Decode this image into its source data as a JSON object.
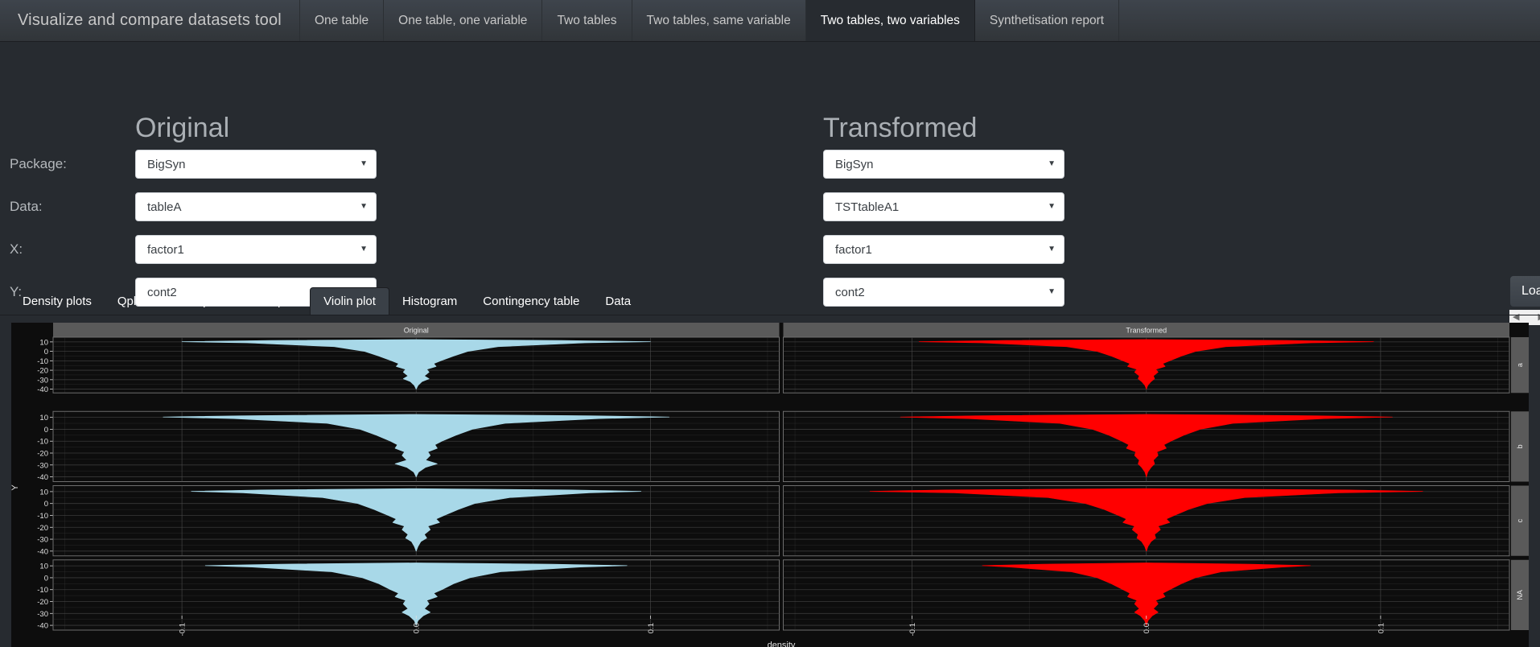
{
  "navbar": {
    "brand": "Visualize and compare datasets tool",
    "tabs": [
      {
        "label": "One table",
        "active": false
      },
      {
        "label": "One table, one variable",
        "active": false
      },
      {
        "label": "Two tables",
        "active": false
      },
      {
        "label": "Two tables, same variable",
        "active": false
      },
      {
        "label": "Two tables, two variables",
        "active": true
      },
      {
        "label": "Synthetisation report",
        "active": false
      }
    ]
  },
  "form": {
    "original_title": "Original",
    "transformed_title": "Transformed",
    "labels": {
      "package": "Package:",
      "data": "Data:",
      "x": "X:",
      "y": "Y:"
    },
    "original": {
      "package": "BigSyn",
      "data": "tableA",
      "x": "factor1",
      "y": "cont2"
    },
    "transformed": {
      "package": "BigSyn",
      "data": "TSTtableA1",
      "x": "factor1",
      "y": "cont2"
    },
    "caret": "▼",
    "load_button": "Load",
    "scroll_left": "◀",
    "scroll_right": "▶"
  },
  "subtabs": [
    {
      "label": "Density plots",
      "active": false
    },
    {
      "label": "Qplot 2",
      "active": false
    },
    {
      "label": "Boxplot",
      "active": false
    },
    {
      "label": "Jitter plot",
      "active": false
    },
    {
      "label": "Violin plot",
      "active": true
    },
    {
      "label": "Histogram",
      "active": false
    },
    {
      "label": "Contingency table",
      "active": false
    },
    {
      "label": "Data",
      "active": false
    }
  ],
  "chart_data": {
    "type": "violin",
    "title": "",
    "panel_titles": [
      "Original",
      "Transformed"
    ],
    "xlabel": "density",
    "ylabel": "Y",
    "facet_labels": [
      "a",
      "b",
      "c",
      "NA"
    ],
    "facet_var": "factor1",
    "x_ticks": [
      "-0.1",
      "0.0",
      "0.1"
    ],
    "x_tick_values": [
      -0.1,
      0.0,
      0.1
    ],
    "xlim": [
      -0.155,
      0.155
    ],
    "y_ticks": [
      "10",
      "0",
      "-10",
      "-20",
      "-30",
      "-40"
    ],
    "y_tick_values": [
      10,
      0,
      -10,
      -20,
      -30,
      -40
    ],
    "ylim": [
      -44,
      15
    ],
    "grid": true,
    "legend": "none",
    "colors": {
      "original_fill": "#a8d8e8",
      "transformed_fill": "#ff0000",
      "panel_bg": "#0d0d0d",
      "strip_bg": "#5a5a5a",
      "grid_line": "#4a4a4a",
      "text": "#e0e0e0"
    },
    "series": [
      {
        "panel": "Original",
        "facet": "a",
        "color": "#a8d8e8",
        "half_widths": [
          {
            "y": 12.5,
            "w": 0.0
          },
          {
            "y": 11.5,
            "w": 0.062
          },
          {
            "y": 10.2,
            "w": 0.1
          },
          {
            "y": 9.0,
            "w": 0.072
          },
          {
            "y": 5.0,
            "w": 0.035
          },
          {
            "y": 0.0,
            "w": 0.022
          },
          {
            "y": -5.0,
            "w": 0.016
          },
          {
            "y": -10.0,
            "w": 0.0105
          },
          {
            "y": -13.0,
            "w": 0.0075
          },
          {
            "y": -16.0,
            "w": 0.0085
          },
          {
            "y": -19.0,
            "w": 0.0045
          },
          {
            "y": -22.0,
            "w": 0.0055
          },
          {
            "y": -26.0,
            "w": 0.0035
          },
          {
            "y": -29.0,
            "w": 0.0055
          },
          {
            "y": -32.0,
            "w": 0.0025
          },
          {
            "y": -36.0,
            "w": 0.0008
          },
          {
            "y": -40.0,
            "w": 0.0
          }
        ]
      },
      {
        "panel": "Original",
        "facet": "b",
        "color": "#a8d8e8",
        "half_widths": [
          {
            "y": 12.5,
            "w": 0.0
          },
          {
            "y": 11.4,
            "w": 0.072
          },
          {
            "y": 10.3,
            "w": 0.108
          },
          {
            "y": 9.0,
            "w": 0.078
          },
          {
            "y": 5.0,
            "w": 0.038
          },
          {
            "y": 0.0,
            "w": 0.024
          },
          {
            "y": -5.0,
            "w": 0.017
          },
          {
            "y": -10.0,
            "w": 0.011
          },
          {
            "y": -13.0,
            "w": 0.008
          },
          {
            "y": -16.0,
            "w": 0.009
          },
          {
            "y": -19.0,
            "w": 0.005
          },
          {
            "y": -22.0,
            "w": 0.006
          },
          {
            "y": -26.0,
            "w": 0.004
          },
          {
            "y": -29.0,
            "w": 0.009
          },
          {
            "y": -32.0,
            "w": 0.004
          },
          {
            "y": -36.0,
            "w": 0.001
          },
          {
            "y": -40.0,
            "w": 0.0
          }
        ]
      },
      {
        "panel": "Original",
        "facet": "c",
        "color": "#a8d8e8",
        "half_widths": [
          {
            "y": 12.5,
            "w": 0.0
          },
          {
            "y": 11.4,
            "w": 0.066
          },
          {
            "y": 10.2,
            "w": 0.096
          },
          {
            "y": 9.0,
            "w": 0.074
          },
          {
            "y": 5.0,
            "w": 0.04
          },
          {
            "y": 0.0,
            "w": 0.025
          },
          {
            "y": -5.0,
            "w": 0.018
          },
          {
            "y": -10.0,
            "w": 0.012
          },
          {
            "y": -13.0,
            "w": 0.0085
          },
          {
            "y": -16.0,
            "w": 0.01
          },
          {
            "y": -19.0,
            "w": 0.005
          },
          {
            "y": -22.0,
            "w": 0.006
          },
          {
            "y": -26.0,
            "w": 0.0035
          },
          {
            "y": -29.0,
            "w": 0.0045
          },
          {
            "y": -32.0,
            "w": 0.002
          },
          {
            "y": -36.0,
            "w": 0.0008
          },
          {
            "y": -40.0,
            "w": 0.0
          }
        ]
      },
      {
        "panel": "Original",
        "facet": "NA",
        "color": "#a8d8e8",
        "half_widths": [
          {
            "y": 12.5,
            "w": 0.0
          },
          {
            "y": 11.4,
            "w": 0.058
          },
          {
            "y": 10.2,
            "w": 0.09
          },
          {
            "y": 9.0,
            "w": 0.07
          },
          {
            "y": 5.0,
            "w": 0.036
          },
          {
            "y": 0.0,
            "w": 0.023
          },
          {
            "y": -5.0,
            "w": 0.016
          },
          {
            "y": -10.0,
            "w": 0.011
          },
          {
            "y": -13.0,
            "w": 0.0075
          },
          {
            "y": -16.0,
            "w": 0.009
          },
          {
            "y": -19.0,
            "w": 0.0045
          },
          {
            "y": -22.0,
            "w": 0.0055
          },
          {
            "y": -26.0,
            "w": 0.0035
          },
          {
            "y": -29.0,
            "w": 0.006
          },
          {
            "y": -32.0,
            "w": 0.003
          },
          {
            "y": -36.0,
            "w": 0.0008
          },
          {
            "y": -40.0,
            "w": 0.0
          }
        ]
      },
      {
        "panel": "Transformed",
        "facet": "a",
        "color": "#ff0000",
        "half_widths": [
          {
            "y": 12.5,
            "w": 0.0
          },
          {
            "y": 11.5,
            "w": 0.06
          },
          {
            "y": 10.2,
            "w": 0.097
          },
          {
            "y": 9.0,
            "w": 0.07
          },
          {
            "y": 5.0,
            "w": 0.034
          },
          {
            "y": 0.0,
            "w": 0.021
          },
          {
            "y": -5.0,
            "w": 0.015
          },
          {
            "y": -10.0,
            "w": 0.01
          },
          {
            "y": -13.0,
            "w": 0.007
          },
          {
            "y": -16.0,
            "w": 0.008
          },
          {
            "y": -19.0,
            "w": 0.004
          },
          {
            "y": -22.0,
            "w": 0.005
          },
          {
            "y": -26.0,
            "w": 0.003
          },
          {
            "y": -29.0,
            "w": 0.0035
          },
          {
            "y": -32.0,
            "w": 0.002
          },
          {
            "y": -36.0,
            "w": 0.0006
          },
          {
            "y": -40.0,
            "w": 0.0
          }
        ]
      },
      {
        "panel": "Transformed",
        "facet": "b",
        "color": "#ff0000",
        "half_widths": [
          {
            "y": 12.5,
            "w": 0.0
          },
          {
            "y": 11.4,
            "w": 0.07
          },
          {
            "y": 10.3,
            "w": 0.105
          },
          {
            "y": 9.0,
            "w": 0.076
          },
          {
            "y": 5.0,
            "w": 0.037
          },
          {
            "y": 0.0,
            "w": 0.023
          },
          {
            "y": -5.0,
            "w": 0.016
          },
          {
            "y": -10.0,
            "w": 0.0105
          },
          {
            "y": -13.0,
            "w": 0.0075
          },
          {
            "y": -16.0,
            "w": 0.0085
          },
          {
            "y": -19.0,
            "w": 0.0045
          },
          {
            "y": -22.0,
            "w": 0.005
          },
          {
            "y": -26.0,
            "w": 0.003
          },
          {
            "y": -29.0,
            "w": 0.0035
          },
          {
            "y": -32.0,
            "w": 0.002
          },
          {
            "y": -36.0,
            "w": 0.0006
          },
          {
            "y": -40.0,
            "w": 0.0
          }
        ]
      },
      {
        "panel": "Transformed",
        "facet": "c",
        "color": "#ff0000",
        "half_widths": [
          {
            "y": 12.5,
            "w": 0.0
          },
          {
            "y": 11.4,
            "w": 0.086
          },
          {
            "y": 10.2,
            "w": 0.118
          },
          {
            "y": 9.0,
            "w": 0.082
          },
          {
            "y": 5.0,
            "w": 0.042
          },
          {
            "y": 0.0,
            "w": 0.026
          },
          {
            "y": -5.0,
            "w": 0.018
          },
          {
            "y": -10.0,
            "w": 0.012
          },
          {
            "y": -13.0,
            "w": 0.0085
          },
          {
            "y": -16.0,
            "w": 0.01
          },
          {
            "y": -19.0,
            "w": 0.005
          },
          {
            "y": -22.0,
            "w": 0.006
          },
          {
            "y": -26.0,
            "w": 0.0035
          },
          {
            "y": -29.0,
            "w": 0.004
          },
          {
            "y": -32.0,
            "w": 0.002
          },
          {
            "y": -36.0,
            "w": 0.0007
          },
          {
            "y": -40.0,
            "w": 0.0
          }
        ]
      },
      {
        "panel": "Transformed",
        "facet": "NA",
        "color": "#ff0000",
        "half_widths": [
          {
            "y": 12.5,
            "w": 0.0
          },
          {
            "y": 11.4,
            "w": 0.044
          },
          {
            "y": 10.2,
            "w": 0.07
          },
          {
            "y": 9.0,
            "w": 0.058
          },
          {
            "y": 5.0,
            "w": 0.032
          },
          {
            "y": 0.0,
            "w": 0.021
          },
          {
            "y": -5.0,
            "w": 0.015
          },
          {
            "y": -10.0,
            "w": 0.01
          },
          {
            "y": -13.0,
            "w": 0.007
          },
          {
            "y": -16.0,
            "w": 0.008
          },
          {
            "y": -19.0,
            "w": 0.004
          },
          {
            "y": -22.0,
            "w": 0.005
          },
          {
            "y": -26.0,
            "w": 0.003
          },
          {
            "y": -29.0,
            "w": 0.005
          },
          {
            "y": -32.0,
            "w": 0.0025
          },
          {
            "y": -36.0,
            "w": 0.0007
          },
          {
            "y": -40.0,
            "w": 0.0
          }
        ]
      }
    ]
  }
}
